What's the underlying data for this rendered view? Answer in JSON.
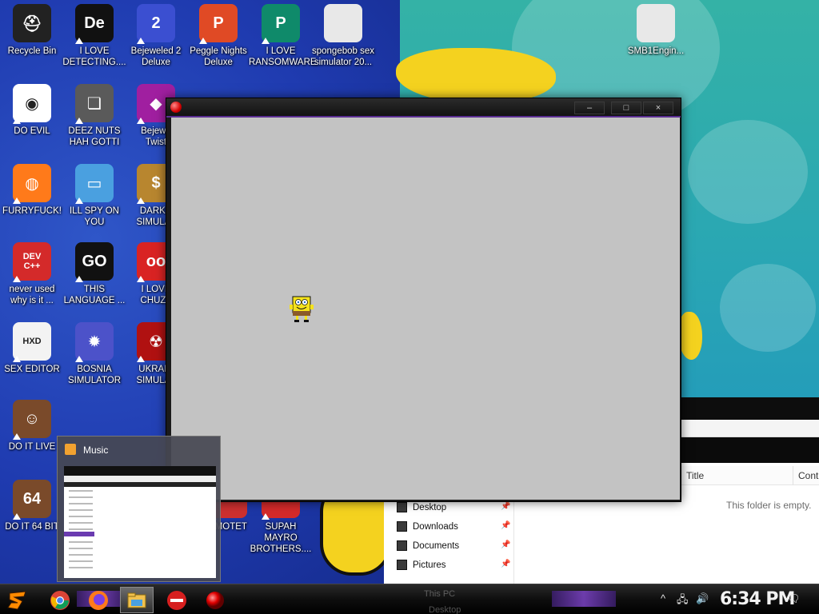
{
  "desktop": {
    "icons": [
      {
        "label": "Recycle Bin",
        "icon": "recycle-bin-icon",
        "color": "#222222",
        "glyph": "⛑"
      },
      {
        "label": "I LOVE\nDETECTING....",
        "icon": "detect-it-easy-icon",
        "color": "#111111",
        "glyph": "De"
      },
      {
        "label": "Bejeweled 2\nDeluxe",
        "icon": "bejeweled-2-icon",
        "color": "#3b4fd1",
        "glyph": "2"
      },
      {
        "label": "Peggle Nights\nDeluxe",
        "icon": "peggle-icon",
        "color": "#e04a25",
        "glyph": "P"
      },
      {
        "label": "I LOVE\nRANSOMWARE",
        "icon": "publisher-icon",
        "color": "#0f8a6a",
        "glyph": "P"
      },
      {
        "label": "spongebob sex\nsimulator 20...",
        "icon": "blank-file-icon",
        "color": "#e8e8e8",
        "glyph": ""
      },
      {
        "label": "SMB1Engin...",
        "icon": "blank-file-icon",
        "color": "#e8e8e8",
        "glyph": ""
      },
      {
        "label": "DO EVIL",
        "icon": "chrome-icon",
        "color": "#ffffff",
        "glyph": "◉"
      },
      {
        "label": "DEEZ NUTS\nHAH GOTTI",
        "icon": "stacked-windows-icon",
        "color": "#5a5a5a",
        "glyph": "❏"
      },
      {
        "label": "Bejewe\nTwist",
        "icon": "bejeweled-twist-icon",
        "color": "#a01fa0",
        "glyph": "◆"
      },
      {
        "label": "FURRYFUCK!",
        "icon": "firefox-icon",
        "color": "#ff7a1a",
        "glyph": "◍"
      },
      {
        "label": "ILL SPY ON\nYOU",
        "icon": "remote-desktop-icon",
        "color": "#4aa0e0",
        "glyph": "▭"
      },
      {
        "label": "DARKC\nSIMULAT",
        "icon": "money-bag-icon",
        "color": "#b8862f",
        "glyph": "$"
      },
      {
        "label": "never used\nwhy is it ...",
        "icon": "devcpp-icon",
        "color": "#d42a2a",
        "glyph": "DEV\nC++"
      },
      {
        "label": "THIS\nLANGUAGE ...",
        "icon": "goland-icon",
        "color": "#111111",
        "glyph": "GO"
      },
      {
        "label": "I LOVE\nCHUZZ",
        "icon": "chuzzle-icon",
        "color": "#d92323",
        "glyph": "oo"
      },
      {
        "label": "SEX EDITOR",
        "icon": "hxd-icon",
        "color": "#f3f3f3",
        "glyph": "HXD"
      },
      {
        "label": "BOSNIA\nSIMULATOR",
        "icon": "spiked-mine-icon",
        "color": "#4c52c9",
        "glyph": "✹"
      },
      {
        "label": "UKRAIN\nSIMULAT",
        "icon": "radiation-icon",
        "color": "#b01111",
        "glyph": "☢"
      },
      {
        "label": "DO IT LIVE",
        "icon": "portrait-icon",
        "color": "#7a4a2a",
        "glyph": "☺"
      },
      {
        "label": "DO IT 64 BIT",
        "icon": "portrait-64-icon",
        "color": "#7a4a2a",
        "glyph": "64"
      },
      {
        "label": "EMOTET",
        "icon": "emotet-icon",
        "color": "#cc3030",
        "glyph": ""
      },
      {
        "label": "SUPAH MAYRO\nBROTHERS....",
        "icon": "mushroom-icon",
        "color": "#d42a2a",
        "glyph": ""
      }
    ]
  },
  "game_window": {
    "minimize": "–",
    "maximize": "□",
    "close": "×"
  },
  "explorer": {
    "nav_items": [
      "Desktop",
      "Downloads",
      "Documents",
      "Pictures"
    ],
    "columns": [
      "Title",
      "Contri"
    ],
    "empty_message": "This folder is empty.",
    "taskbar_peek": [
      "This PC",
      "Desktop"
    ]
  },
  "thumbnail": {
    "title": "Music"
  },
  "taskbar": {
    "clock": "6:34 PM",
    "tray_chevron": "^",
    "buttons": [
      {
        "name": "start-button",
        "icon": "start-logo-icon"
      },
      {
        "name": "taskbar-chrome",
        "icon": "chrome-icon"
      },
      {
        "name": "taskbar-firefox",
        "icon": "firefox-icon"
      },
      {
        "name": "taskbar-file-explorer",
        "icon": "folder-icon"
      },
      {
        "name": "taskbar-no-entry",
        "icon": "no-entry-icon"
      },
      {
        "name": "taskbar-red-ball",
        "icon": "red-ball-icon"
      }
    ]
  }
}
